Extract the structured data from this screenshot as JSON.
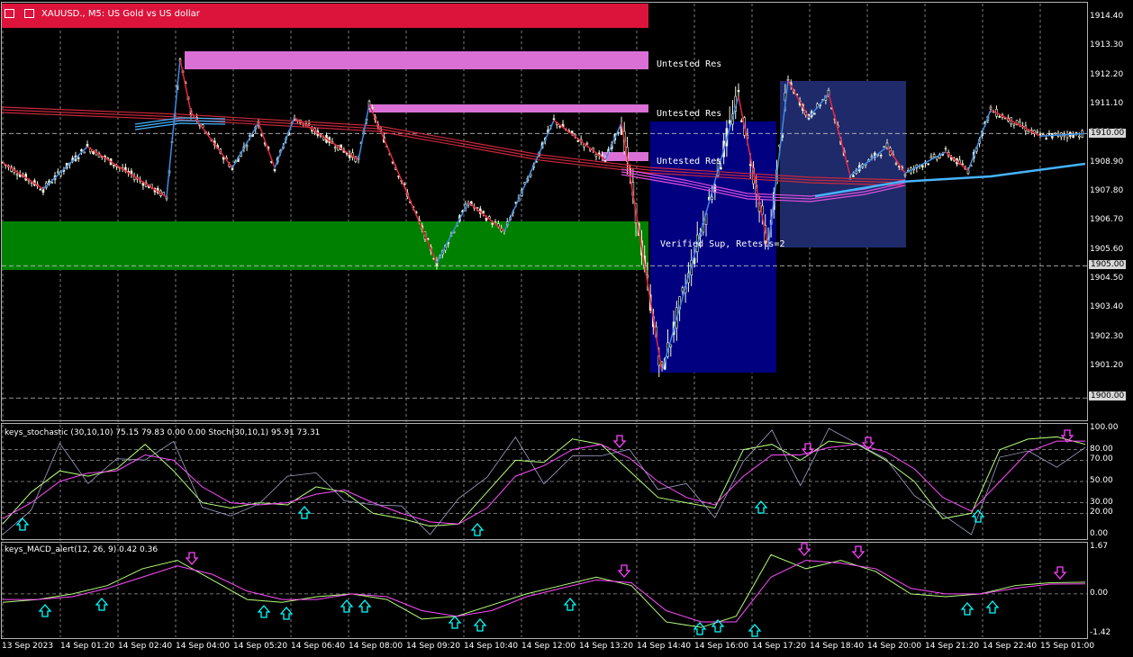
{
  "window": {
    "title": "XAUUSD., M5:  US Gold vs US dollar"
  },
  "colors": {
    "background": "#000000",
    "bear_zone": "#dc143c",
    "resistance_zone": "#da70d6",
    "support_zone": "#008000",
    "blue_box": "#000080",
    "gray_box": "#1f2a6b",
    "ma_red": "#c8283c",
    "ma_blue": "#46b4ff",
    "ma_magenta": "#dc50dc",
    "zigzag_up": "#3c8ce6",
    "zigzag_down": "#e6283c",
    "stoch_main": "#b4ff78",
    "stoch_signal": "#ff4cff",
    "stoch_raw": "#a0a0c8",
    "arrow_up": "#00ffff",
    "arrow_down": "#ff40ff"
  },
  "zones": {
    "untested_res_1": "Untested Res",
    "untested_res_2": "Untested Res",
    "untested_res_3": "Untested Res",
    "verified_sup": "Verified Sup, Retests=2"
  },
  "main_axis": {
    "ticks": [
      "1914.40",
      "1913.30",
      "1912.20",
      "1911.10",
      "1910.00",
      "1908.90",
      "1907.80",
      "1906.70",
      "1905.60",
      "1904.50",
      "1903.40",
      "1902.30",
      "1901.20"
    ],
    "current_price": "1910.00",
    "level_1905": "1905.00",
    "level_1900": "1900.00"
  },
  "stochastic": {
    "label": "keys_stochastic (30,10,10) 75.15 79.83 0.00 0.00 Stoch(30,10,1) 95.91 73.31",
    "ticks": [
      "100.00",
      "80.00",
      "70.00",
      "50.00",
      "30.00",
      "20.00",
      "0.00"
    ]
  },
  "macd": {
    "label": "keys_MACD_alert(12, 26, 9) 0.42 0.36",
    "ticks": [
      "1.67",
      "0.00",
      "-1.42"
    ]
  },
  "time_axis": [
    "13 Sep 2023",
    "14 Sep 01:20",
    "14 Sep 02:40",
    "14 Sep 04:00",
    "14 Sep 05:20",
    "14 Sep 06:40",
    "14 Sep 08:00",
    "14 Sep 09:20",
    "14 Sep 10:40",
    "14 Sep 12:00",
    "14 Sep 13:20",
    "14 Sep 14:40",
    "14 Sep 16:00",
    "14 Sep 17:20",
    "14 Sep 18:40",
    "14 Sep 20:00",
    "14 Sep 21:20",
    "14 Sep 22:40",
    "15 Sep 01:00"
  ],
  "chart_data": [
    {
      "type": "candlestick",
      "title": "XAUUSD., M5:  US Gold vs US dollar",
      "ylim": [
        1899.6,
        1914.9
      ],
      "zigzag": {
        "time": [
          "13 Sep 2023",
          "",
          "14 Sep 01:20",
          "14 Sep 02:40",
          "",
          "14 Sep 04:00",
          "",
          "14 Sep 05:20",
          "",
          "14 Sep 06:40",
          "",
          "14 Sep 08:00",
          "14 Sep 09:20",
          "14 Sep 10:40",
          "",
          "14 Sep 12:00",
          "14 Sep 13:20",
          "",
          "14 Sep 14:40",
          "14 Sep 16:00",
          "",
          "14 Sep 17:20",
          "",
          "14 Sep 18:40",
          "",
          "14 Sep 20:00",
          "",
          "14 Sep 21:20",
          "14 Sep 22:40",
          "",
          "15 Sep 01:00",
          ""
        ],
        "price": [
          1908.9,
          1907.9,
          1909.5,
          1907.6,
          1912.8,
          1910.8,
          1908.7,
          1910.4,
          1908.7,
          1910.6,
          1909.0,
          1911.1,
          1905.1,
          1907.4,
          1906.3,
          1910.5,
          1909.0,
          1910.4,
          1901.0,
          1911.4,
          1905.7,
          1912.0,
          1910.6,
          1911.5,
          1908.4,
          1909.5,
          1908.5,
          1909.3,
          1908.6,
          1910.9,
          1909.9,
          1910.0
        ]
      },
      "moving_averages": [
        "red EMA band",
        "magenta EMA band",
        "blue EMA"
      ],
      "levels": [
        1910.0,
        1905.0,
        1900.0
      ]
    },
    {
      "type": "line",
      "title": "keys_stochastic (30,10,10) 75.15 79.83 0.00 0.00 Stoch(30,10,1) 95.91 73.31",
      "ylim": [
        0,
        100
      ],
      "levels": [
        80,
        70,
        50,
        30,
        20
      ],
      "series": [
        {
          "name": "main",
          "values": [
            10,
            40,
            60,
            55,
            62,
            85,
            60,
            30,
            25,
            30,
            28,
            45,
            40,
            20,
            15,
            8,
            10,
            40,
            70,
            68,
            90,
            85,
            60,
            35,
            30,
            25,
            80,
            85,
            70,
            88,
            85,
            70,
            50,
            15,
            20,
            80,
            90,
            92,
            85
          ]
        },
        {
          "name": "signal",
          "values": [
            15,
            30,
            50,
            58,
            60,
            75,
            70,
            45,
            30,
            28,
            30,
            38,
            42,
            30,
            20,
            12,
            10,
            25,
            55,
            65,
            80,
            85,
            72,
            50,
            35,
            28,
            55,
            75,
            75,
            82,
            85,
            78,
            62,
            35,
            22,
            50,
            78,
            88,
            88
          ]
        }
      ]
    },
    {
      "type": "line",
      "title": "keys_MACD_alert(12, 26, 9) 0.42 0.36",
      "ylim": [
        -1.42,
        1.67
      ],
      "series": [
        {
          "name": "macd",
          "values": [
            -0.3,
            -0.2,
            0.0,
            0.3,
            0.9,
            1.2,
            0.5,
            -0.2,
            -0.3,
            -0.1,
            0.0,
            -0.2,
            -0.9,
            -0.8,
            -0.4,
            0.0,
            0.3,
            0.6,
            0.3,
            -1.0,
            -1.2,
            -0.8,
            1.4,
            0.9,
            1.2,
            0.8,
            0.0,
            -0.1,
            0.0,
            0.3,
            0.4,
            0.42
          ]
        },
        {
          "name": "signal",
          "values": [
            -0.2,
            -0.2,
            -0.1,
            0.2,
            0.6,
            1.0,
            0.7,
            0.1,
            -0.2,
            -0.2,
            0.0,
            -0.1,
            -0.6,
            -0.8,
            -0.6,
            -0.1,
            0.2,
            0.5,
            0.4,
            -0.6,
            -1.0,
            -1.0,
            0.6,
            1.2,
            1.1,
            0.9,
            0.2,
            0.0,
            0.0,
            0.2,
            0.35,
            0.36
          ]
        }
      ]
    }
  ]
}
